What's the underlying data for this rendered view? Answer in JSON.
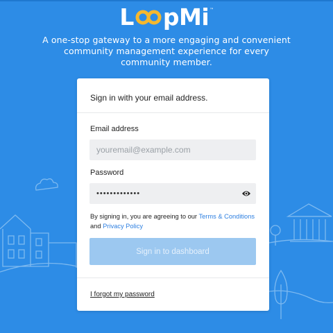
{
  "brand": {
    "name": "LoopMi",
    "logo_letters_left": "L",
    "logo_letters_right": "pMi",
    "trademark": "™",
    "logo_accent_color": "#f5b82e"
  },
  "tagline": "A one-stop gateway to a more engaging and convenient community management experience for every community member.",
  "signin": {
    "header": "Sign in with your email address.",
    "email_label": "Email address",
    "email_placeholder": "youremail@example.com",
    "password_label": "Password",
    "password_value": "•••••••••••••",
    "show_password_icon": "eye-icon",
    "terms_prefix": "By signing in, you are agreeing to our ",
    "terms_link": "Terms & Conditions",
    "terms_and": "and ",
    "privacy_link": "Privacy Policy",
    "submit_label": "Sign in to dashboard",
    "forgot_link": "I forgot my password"
  },
  "colors": {
    "background": "#2d8ce6",
    "button_disabled": "#9cc8f0",
    "link": "#2d7fe0"
  }
}
